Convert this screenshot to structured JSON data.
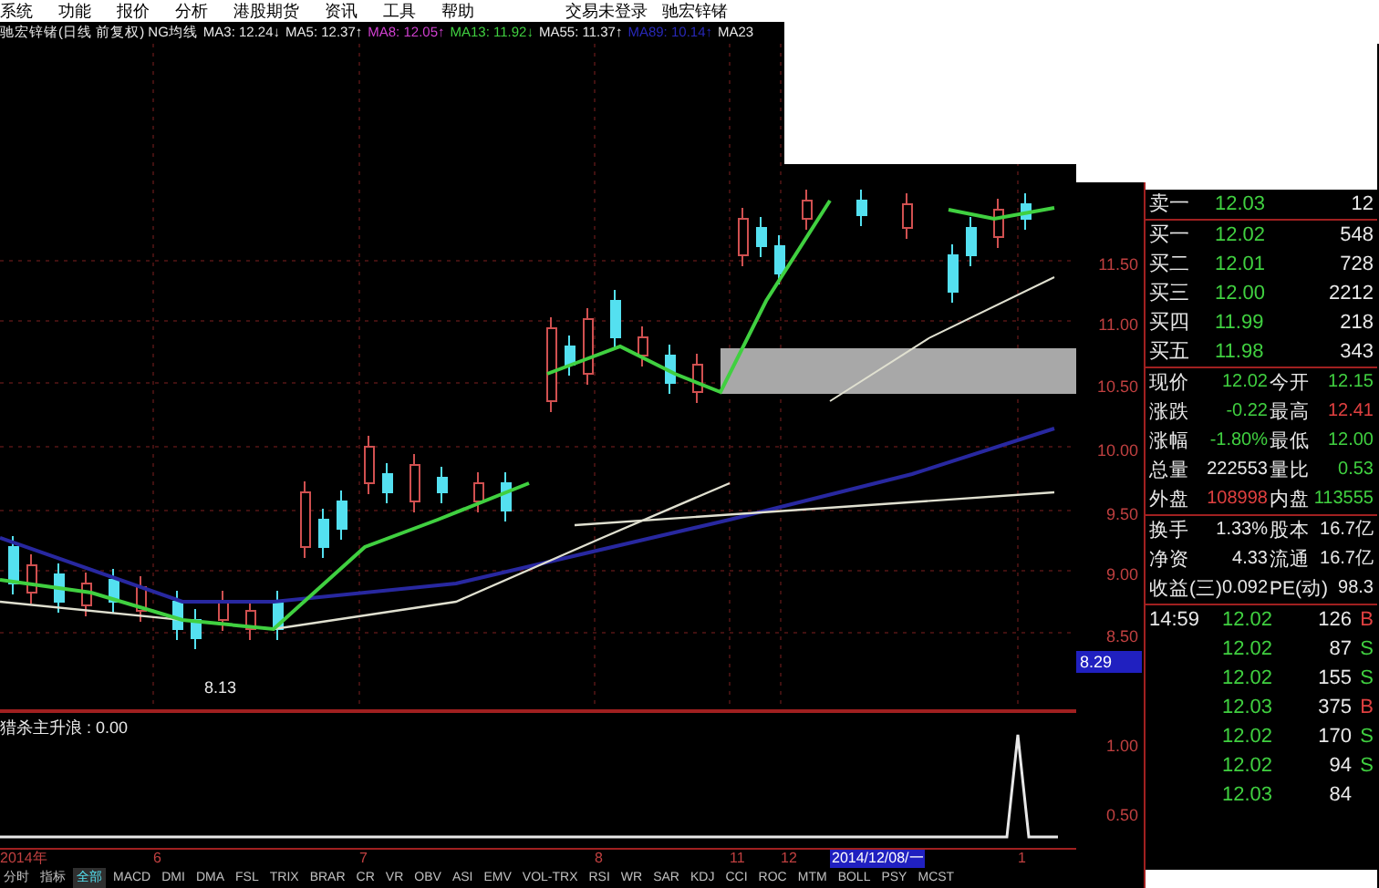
{
  "menu": [
    "系统",
    "功能",
    "报价",
    "分析",
    "港股期货",
    "资讯",
    "工具",
    "帮助"
  ],
  "account": [
    "交易未登录",
    "驰宏锌锗"
  ],
  "title": "驰宏锌锗(日线 前复权) NG均线",
  "indicators": [
    {
      "text": "MA3: 12.24↓",
      "color": "#e8e8e8"
    },
    {
      "text": "MA5: 12.37↑",
      "color": "#e8e8e8"
    },
    {
      "text": "MA8: 12.05↑",
      "color": "#d040d0"
    },
    {
      "text": "MA13: 11.92↓",
      "color": "#40d040"
    },
    {
      "text": "MA55: 11.37↑",
      "color": "#e8e8e8"
    },
    {
      "text": "MA89: 10.14↑",
      "color": "#2828b8"
    },
    {
      "text": "MA23",
      "color": "#e8e8e8"
    }
  ],
  "price_axis": [
    "11.50",
    "11.00",
    "10.50",
    "10.00",
    "9.50",
    "9.00",
    "8.50"
  ],
  "cursor_price": "8.29",
  "low_label": "8.13",
  "sub_indicator": {
    "label": "猎杀主升浪 : 0.00",
    "axis": [
      "1.00",
      "0.50"
    ]
  },
  "date_axis": [
    "2014年",
    "6",
    "7",
    "8",
    "11",
    "12",
    "1"
  ],
  "date_cursor": "2014/12/08/一",
  "tabs": [
    {
      "label": "分时",
      "selected": false
    },
    {
      "label": "指标",
      "selected": false
    },
    {
      "label": "全部",
      "selected": true
    },
    {
      "label": "MACD",
      "selected": false
    },
    {
      "label": "DMI",
      "selected": false
    },
    {
      "label": "DMA",
      "selected": false
    },
    {
      "label": "FSL",
      "selected": false
    },
    {
      "label": "TRIX",
      "selected": false
    },
    {
      "label": "BRAR",
      "selected": false
    },
    {
      "label": "CR",
      "selected": false
    },
    {
      "label": "VR",
      "selected": false
    },
    {
      "label": "OBV",
      "selected": false
    },
    {
      "label": "ASI",
      "selected": false
    },
    {
      "label": "EMV",
      "selected": false
    },
    {
      "label": "VOL-TRX",
      "selected": false
    },
    {
      "label": "RSI",
      "selected": false
    },
    {
      "label": "WR",
      "selected": false
    },
    {
      "label": "SAR",
      "selected": false
    },
    {
      "label": "KDJ",
      "selected": false
    },
    {
      "label": "CCI",
      "selected": false
    },
    {
      "label": "ROC",
      "selected": false
    },
    {
      "label": "MTM",
      "selected": false
    },
    {
      "label": "BOLL",
      "selected": false
    },
    {
      "label": "PSY",
      "selected": false
    },
    {
      "label": "MCST",
      "selected": false
    }
  ],
  "asks": [
    {
      "label": "卖一",
      "price": "12.03",
      "volume": "12"
    }
  ],
  "bids": [
    {
      "label": "买一",
      "price": "12.02",
      "volume": "548"
    },
    {
      "label": "买二",
      "price": "12.01",
      "volume": "728"
    },
    {
      "label": "买三",
      "price": "12.00",
      "volume": "2212"
    },
    {
      "label": "买四",
      "price": "11.99",
      "volume": "218"
    },
    {
      "label": "买五",
      "price": "11.98",
      "volume": "343"
    }
  ],
  "stats": [
    {
      "cells": [
        {
          "label": "现价",
          "value": "12.02",
          "color": "#40d040"
        },
        {
          "label": "今开",
          "value": "12.15",
          "color": "#40d040"
        }
      ]
    },
    {
      "cells": [
        {
          "label": "涨跌",
          "value": "-0.22",
          "color": "#40d040"
        },
        {
          "label": "最高",
          "value": "12.41",
          "color": "#e04040"
        }
      ]
    },
    {
      "cells": [
        {
          "label": "涨幅",
          "value": "-1.80%",
          "color": "#40d040"
        },
        {
          "label": "最低",
          "value": "12.00",
          "color": "#40d040"
        }
      ]
    },
    {
      "cells": [
        {
          "label": "总量",
          "value": "222553",
          "color": "#e8e8e8"
        },
        {
          "label": "量比",
          "value": "0.53",
          "color": "#40d040"
        }
      ]
    },
    {
      "cells": [
        {
          "label": "外盘",
          "value": "108998",
          "color": "#e04040"
        },
        {
          "label": "内盘",
          "value": "113555",
          "color": "#40d040"
        }
      ]
    }
  ],
  "finance": [
    {
      "cells": [
        {
          "label": "换手",
          "value": "1.33%"
        },
        {
          "label": "股本",
          "value": "16.7亿"
        }
      ]
    },
    {
      "cells": [
        {
          "label": "净资",
          "value": "4.33"
        },
        {
          "label": "流通",
          "value": "16.7亿"
        }
      ]
    },
    {
      "cells": [
        {
          "label": "收益(三)",
          "value": "0.092"
        },
        {
          "label": "PE(动)",
          "value": "98.3"
        }
      ]
    }
  ],
  "ticks": [
    {
      "time": "14:59",
      "price": "12.02",
      "volume": "126",
      "side": "B",
      "color": "#e04040"
    },
    {
      "price": "12.02",
      "volume": "87",
      "side": "S",
      "color": "#40d040"
    },
    {
      "price": "12.02",
      "volume": "155",
      "side": "S",
      "color": "#40d040"
    },
    {
      "price": "12.03",
      "volume": "375",
      "side": "B",
      "color": "#e04040"
    },
    {
      "price": "12.02",
      "volume": "170",
      "side": "S",
      "color": "#40d040"
    },
    {
      "price": "12.02",
      "volume": "94",
      "side": "S",
      "color": "#40d040"
    },
    {
      "price": "12.03",
      "volume": "84"
    }
  ]
}
